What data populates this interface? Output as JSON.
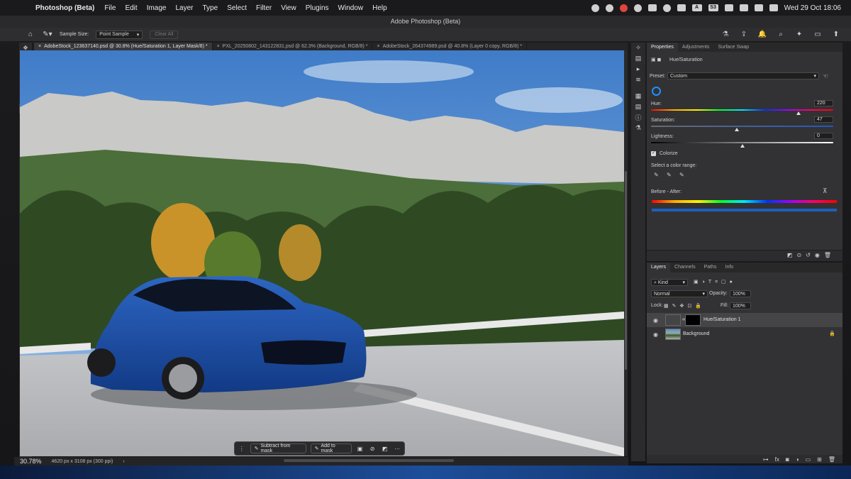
{
  "menubar": {
    "app_name": "Photoshop (Beta)",
    "items": [
      "File",
      "Edit",
      "Image",
      "Layer",
      "Type",
      "Select",
      "Filter",
      "View",
      "Plugins",
      "Window",
      "Help"
    ],
    "tray_badges": [
      "A",
      "S3"
    ],
    "clock": "Wed 29 Oct  18:06"
  },
  "window": {
    "title": "Adobe Photoshop (Beta)"
  },
  "options_bar": {
    "sample_size_label": "Sample Size:",
    "sample_size_value": "Point Sample",
    "clear_all_label": "Clear All"
  },
  "tabs": [
    {
      "label": "AdobeStock_123637140.psd @ 30.8% (Hue/Saturation 1, Layer Mask/8) *",
      "active": true
    },
    {
      "label": "PXL_20250802_143122831.psd @ 62.3% (Background, RGB/8) *",
      "active": false
    },
    {
      "label": "AdobeStock_264374989.psd @ 40.8% (Layer 0 copy, RGB/8) *",
      "active": false
    }
  ],
  "context_taskbar": {
    "subtract_label": "Subtract from mask",
    "add_label": "Add to mask",
    "more_label": "···"
  },
  "status": {
    "zoom": "30.78%",
    "doc_info": "4620 px x 3108 px (300 ppi)",
    "arrow": "›"
  },
  "properties": {
    "tabs": [
      "Properties",
      "Adjustments",
      "Surface Swap"
    ],
    "panel_title": "Hue/Saturation",
    "preset_label": "Preset:",
    "preset_value": "Custom",
    "hue_label": "Hue:",
    "hue_value": "220",
    "hue_fraction": 0.81,
    "saturation_label": "Saturation:",
    "saturation_value": "47",
    "saturation_fraction": 0.47,
    "lightness_label": "Lightness:",
    "lightness_value": "0",
    "lightness_fraction": 0.5,
    "colorize_label": "Colorize",
    "colorize_checked": true,
    "range_label": "Select a color range:",
    "before_after_label": "Before - After:"
  },
  "layers": {
    "tabs": [
      "Layers",
      "Channels",
      "Paths",
      "Info"
    ],
    "filter_value": "Kind",
    "blend_mode": "Normal",
    "opacity_label": "Opacity:",
    "opacity_value": "100%",
    "lock_label": "Lock:",
    "fill_label": "Fill:",
    "fill_value": "100%",
    "rows": [
      {
        "name": "Hue/Saturation 1",
        "selected": true
      },
      {
        "name": "Background",
        "selected": false
      }
    ]
  },
  "colors": {
    "accent": "#1e90ff",
    "car": "#1f4fa8",
    "sky": "#5a8fd0"
  }
}
